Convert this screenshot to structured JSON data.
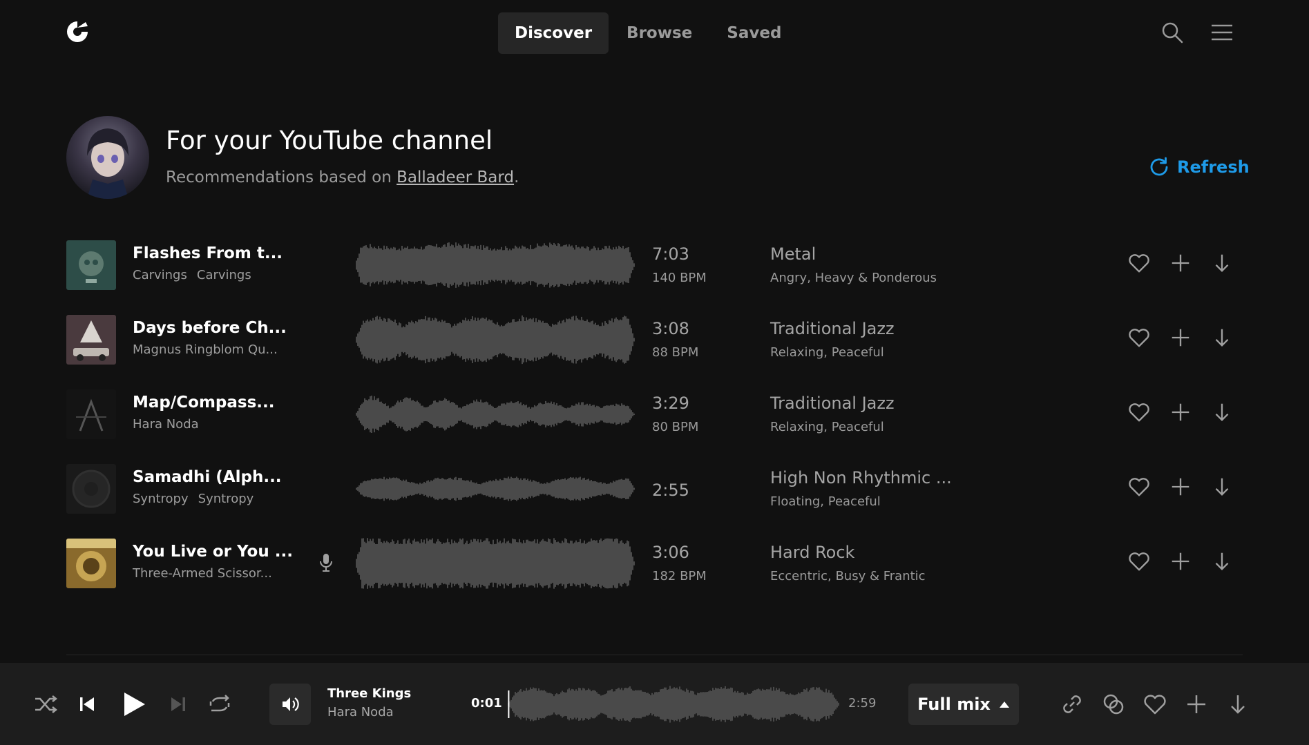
{
  "header": {
    "logo": "app-logo",
    "tabs": [
      {
        "label": "Discover",
        "active": true
      },
      {
        "label": "Browse",
        "active": false
      },
      {
        "label": "Saved",
        "active": false
      }
    ],
    "icons": [
      "search-icon",
      "menu-icon"
    ]
  },
  "hero": {
    "title": "For your YouTube channel",
    "subtitle_prefix": "Recommendations based on ",
    "channel_name": "Balladeer Bard",
    "subtitle_suffix": ".",
    "refresh_label": "Refresh"
  },
  "tracks": [
    {
      "title": "Flashes From t...",
      "artists": [
        "Carvings",
        "Carvings"
      ],
      "duration": "7:03",
      "bpm": "140 BPM",
      "genre": "Metal",
      "moods": "Angry, Heavy & Ponderous",
      "vocal": false
    },
    {
      "title": "Days before Ch...",
      "artists": [
        "Magnus Ringblom Qu..."
      ],
      "duration": "3:08",
      "bpm": "88 BPM",
      "genre": "Traditional Jazz",
      "moods": "Relaxing, Peaceful",
      "vocal": false
    },
    {
      "title": "Map/Compass...",
      "artists": [
        "Hara Noda"
      ],
      "duration": "3:29",
      "bpm": "80 BPM",
      "genre": "Traditional Jazz",
      "moods": "Relaxing, Peaceful",
      "vocal": false
    },
    {
      "title": "Samadhi (Alph...",
      "artists": [
        "Syntropy",
        "Syntropy"
      ],
      "duration": "2:55",
      "bpm": "",
      "genre": "High Non Rhythmic ...",
      "moods": "Floating, Peaceful",
      "vocal": false
    },
    {
      "title": "You Live or You ...",
      "artists": [
        "Three-Armed Scissor..."
      ],
      "duration": "3:06",
      "bpm": "182 BPM",
      "genre": "Hard Rock",
      "moods": "Eccentric, Busy & Frantic",
      "vocal": true
    }
  ],
  "player": {
    "now_playing_title": "Three Kings",
    "now_playing_artist": "Hara Noda",
    "elapsed": "0:01",
    "total": "2:59",
    "progress": 0.005,
    "mix_label": "Full mix",
    "controls": [
      "shuffle-icon",
      "previous-icon",
      "play-icon",
      "next-icon",
      "repeat-icon",
      "volume-icon"
    ],
    "actions": [
      "link-icon",
      "similar-icon",
      "heart-icon",
      "plus-icon",
      "download-icon"
    ]
  },
  "colors": {
    "background": "#111111",
    "player_background": "#1d1d1d",
    "accent": "#1e9be9",
    "waveform": "#4a4a4a"
  }
}
